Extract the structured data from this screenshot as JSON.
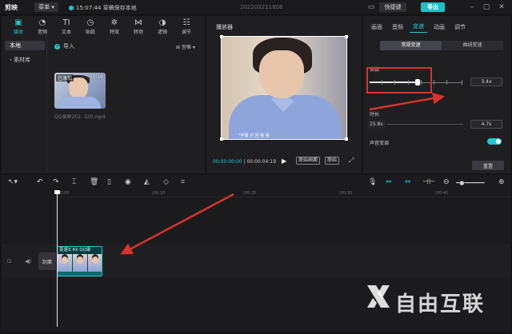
{
  "app": {
    "logo": "剪映",
    "menu": "菜单",
    "autosave": "15:07:44 草稿保存本地",
    "project_title": "202203211808",
    "kbd": "快捷键",
    "export": "导出"
  },
  "media": {
    "tool_tabs": [
      {
        "icon": "media-icon",
        "glyph": "▣",
        "label": "媒体"
      },
      {
        "icon": "audio-icon",
        "glyph": "◔",
        "label": "音频"
      },
      {
        "icon": "text-icon",
        "glyph": "TI",
        "label": "文本"
      },
      {
        "icon": "sticker-icon",
        "glyph": "◷",
        "label": "贴纸"
      },
      {
        "icon": "effects-icon",
        "glyph": "✲",
        "label": "特效"
      },
      {
        "icon": "transition-icon",
        "glyph": "⋈",
        "label": "转场"
      },
      {
        "icon": "filter-icon",
        "glyph": "◑",
        "label": "滤镜"
      },
      {
        "icon": "adjust-icon",
        "glyph": "☷",
        "label": "调节"
      }
    ],
    "side": [
      "本地",
      "› 素材库"
    ],
    "import": "导入",
    "sort": "⊞ 宫格 ▾",
    "clip": {
      "added": "已添加",
      "duration": "00:16",
      "name": "QQ录屏202..320.mp4"
    }
  },
  "player": {
    "title": "播放器",
    "subtitle": "*字幕 只 回 看 看",
    "time_current": "00:00:00:00",
    "time_total": "00:00:04:19",
    "btn_original": "原始画面",
    "btn_ratio": "原始",
    "fullscreen": "⤢"
  },
  "properties": {
    "tabs": [
      "画面",
      "音频",
      "变速",
      "动画",
      "调节"
    ],
    "active_tab": 2,
    "modes": [
      "常规变速",
      "曲线变速"
    ],
    "speed_label": "倍数",
    "speed_value": "3.4x",
    "speed_fraction": 0.52,
    "duration_label": "时长",
    "duration_in": "15.8s",
    "duration_out": "4.7s",
    "pitch_label": "声音变调",
    "reset": "重置"
  },
  "timeline": {
    "ruler": [
      "00:00",
      "|00:10",
      "|00:20",
      "|00:30",
      "|00:40"
    ],
    "cover": "封面",
    "clip_label": "变速3.4X  QQ录",
    "watermark": "自由互联"
  }
}
